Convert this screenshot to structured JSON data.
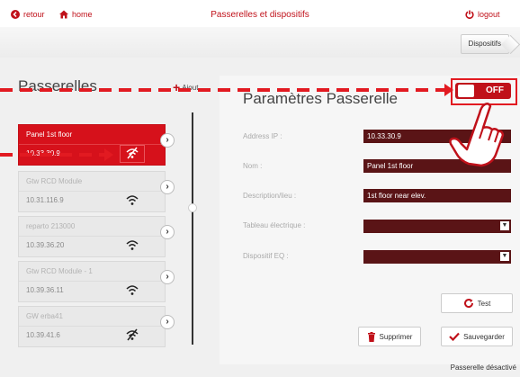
{
  "topbar": {
    "back_label": "retour",
    "home_label": "home",
    "title": "Passerelles et dispositifs",
    "logout_label": "logout"
  },
  "subbar": {
    "dispositifs_label": "Dispositifs"
  },
  "gateways_panel": {
    "title": "Passerelles",
    "add_label": "Ajout",
    "items": [
      {
        "name": "Panel 1st floor",
        "ip": "10.33.30.9",
        "wifi": "disabled",
        "selected": true
      },
      {
        "name": "Gtw RCD Module",
        "ip": "10.31.116.9",
        "wifi": "enabled",
        "selected": false
      },
      {
        "name": "reparto 213000",
        "ip": "10.39.36.20",
        "wifi": "enabled",
        "selected": false
      },
      {
        "name": "Gtw RCD Module - 1",
        "ip": "10.39.36.11",
        "wifi": "enabled",
        "selected": false
      },
      {
        "name": "GW erba41",
        "ip": "10.39.41.6",
        "wifi": "disabled",
        "selected": false
      }
    ]
  },
  "params": {
    "title": "Paramètres Passerelle",
    "toggle_label": "OFF",
    "fields": [
      {
        "label": "Address IP :",
        "value": "10.33.30.9"
      },
      {
        "label": "Nom :",
        "value": "Panel 1st floor"
      },
      {
        "label": "Description/lieu :",
        "value": "1st floor near elev."
      },
      {
        "label": "Tableau électrique :",
        "value": ""
      },
      {
        "label": "Dispositif EQ :",
        "value": ""
      }
    ],
    "test_label": "Test",
    "delete_label": "Supprimer",
    "save_label": "Sauvegarder",
    "status": "Passerelle désactivé"
  },
  "colors": {
    "accent": "#c0111a",
    "annotation": "#e21a21",
    "field_bg": "#5a1416"
  }
}
